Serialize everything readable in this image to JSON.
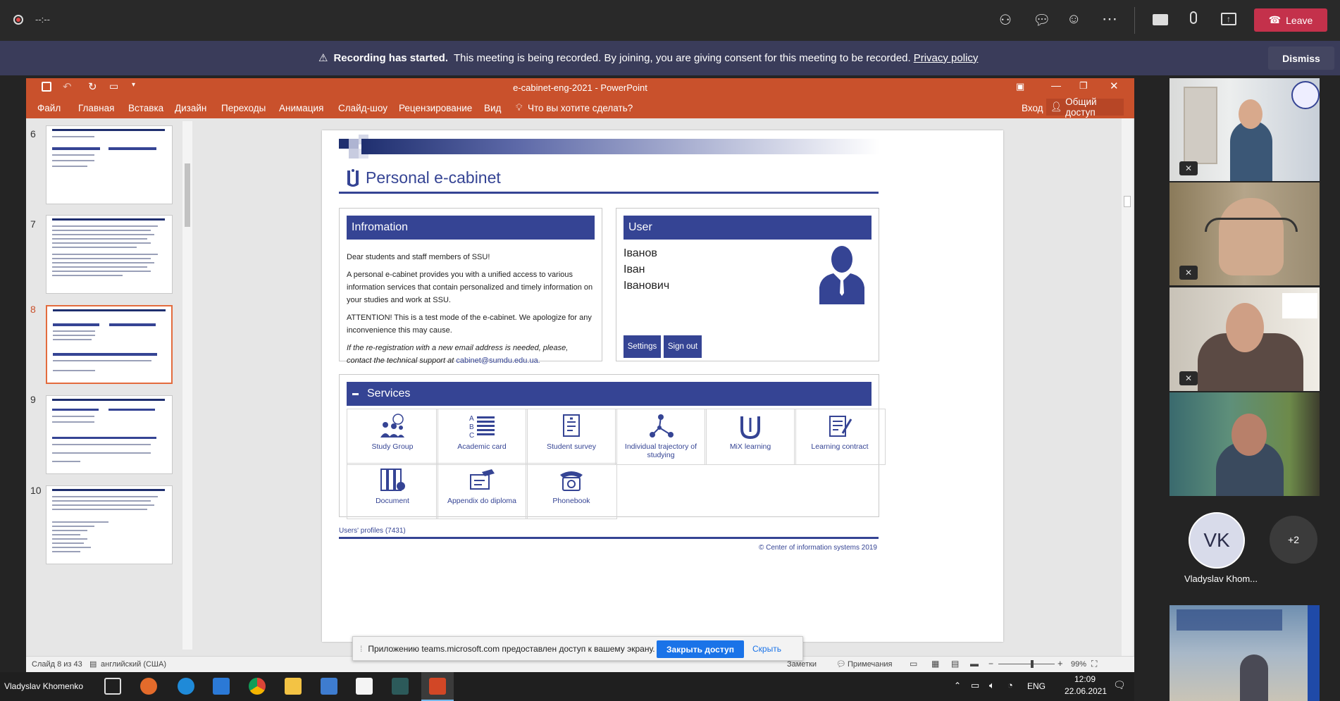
{
  "teams": {
    "timer": "--:--",
    "leave_label": "Leave",
    "recording_bold": "Recording has started.",
    "recording_text": "This meeting is being recorded. By joining, you are giving consent for this meeting to be recorded.",
    "privacy_link": "Privacy policy",
    "dismiss_label": "Dismiss",
    "participants": [
      {
        "initials": "VK",
        "name": "Vladyslav Khom..."
      }
    ],
    "more_count": "+2"
  },
  "ppt": {
    "window_title": "e-cabinet-eng-2021 - PowerPoint",
    "menu": [
      "Файл",
      "Главная",
      "Вставка",
      "Дизайн",
      "Переходы",
      "Анимация",
      "Слайд-шоу",
      "Рецензирование",
      "Вид"
    ],
    "tell_me": "Что вы хотите сделать?",
    "signin": "Вход",
    "share": "Общий доступ",
    "thumbnails": [
      "6",
      "7",
      "8",
      "9",
      "10"
    ],
    "status_slide": "Слайд 8 из 43",
    "status_lang": "английский (США)",
    "status_notes": "Заметки",
    "status_comments": "Примечания",
    "zoom": "99%"
  },
  "slide": {
    "title": "Personal e-cabinet",
    "info_header": "Infromation",
    "info_p1": "Dear students and staff members of SSU!",
    "info_p2": "A personal e-cabinet provides you with a unified access to various information services that contain personalized and timely information on your studies and work at SSU.",
    "info_p3": "ATTENTION! This is a test mode of the e-cabinet. We apologize for any inconvenience this may cause.",
    "info_p4": "If the re-registration with a new email address is needed, please, contact the technical support at",
    "info_email": "cabinet@sumdu.edu.ua.",
    "user_header": "User",
    "surname": "Іванов",
    "firstname": "Іван",
    "patronymic": "Іванович",
    "settings_label": "Settings",
    "signout_label": "Sign out",
    "services_header": "Services",
    "services": [
      "Study Group",
      "Academic card",
      "Student survey",
      "Individual trajectory of studying",
      "MiX learning",
      "Learning contract",
      "Document",
      "Appendix do diploma",
      "Phonebook"
    ],
    "profiles": "Users' profiles (7431)",
    "copyright": "© Center of information systems 2019"
  },
  "share_bar": {
    "text": "Приложению teams.microsoft.com предоставлен доступ к вашему экрану.",
    "stop_label": "Закрыть доступ",
    "hide_label": "Скрыть"
  },
  "taskbar": {
    "user": "Vladyslav Khomenko",
    "lang": "ENG",
    "time": "12:09",
    "date": "22.06.2021"
  },
  "colors": {
    "accent": "#354494",
    "ppt": "#c9512c",
    "leave": "#c4314b",
    "teams_blue": "#1a73e8"
  }
}
